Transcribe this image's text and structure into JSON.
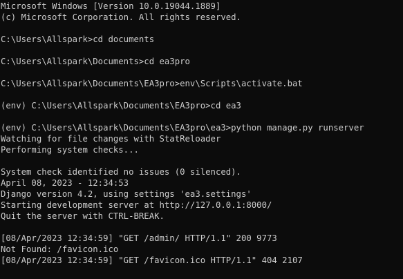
{
  "theme": {
    "background": "#0c0c0c",
    "foreground": "#cccccc"
  },
  "console": {
    "lines": [
      "Microsoft Windows [Version 10.0.19044.1889]",
      "(c) Microsoft Corporation. All rights reserved.",
      "",
      "C:\\Users\\Allspark>cd documents",
      "",
      "C:\\Users\\Allspark\\Documents>cd ea3pro",
      "",
      "C:\\Users\\Allspark\\Documents\\EA3pro>env\\Scripts\\activate.bat",
      "",
      "(env) C:\\Users\\Allspark\\Documents\\EA3pro>cd ea3",
      "",
      "(env) C:\\Users\\Allspark\\Documents\\EA3pro\\ea3>python manage.py runserver",
      "Watching for file changes with StatReloader",
      "Performing system checks...",
      "",
      "System check identified no issues (0 silenced).",
      "April 08, 2023 - 12:34:53",
      "Django version 4.2, using settings 'ea3.settings'",
      "Starting development server at http://127.0.0.1:8000/",
      "Quit the server with CTRL-BREAK.",
      "",
      "[08/Apr/2023 12:34:59] \"GET /admin/ HTTP/1.1\" 200 9773",
      "Not Found: /favicon.ico",
      "[08/Apr/2023 12:34:59] \"GET /favicon.ico HTTP/1.1\" 404 2107"
    ]
  }
}
